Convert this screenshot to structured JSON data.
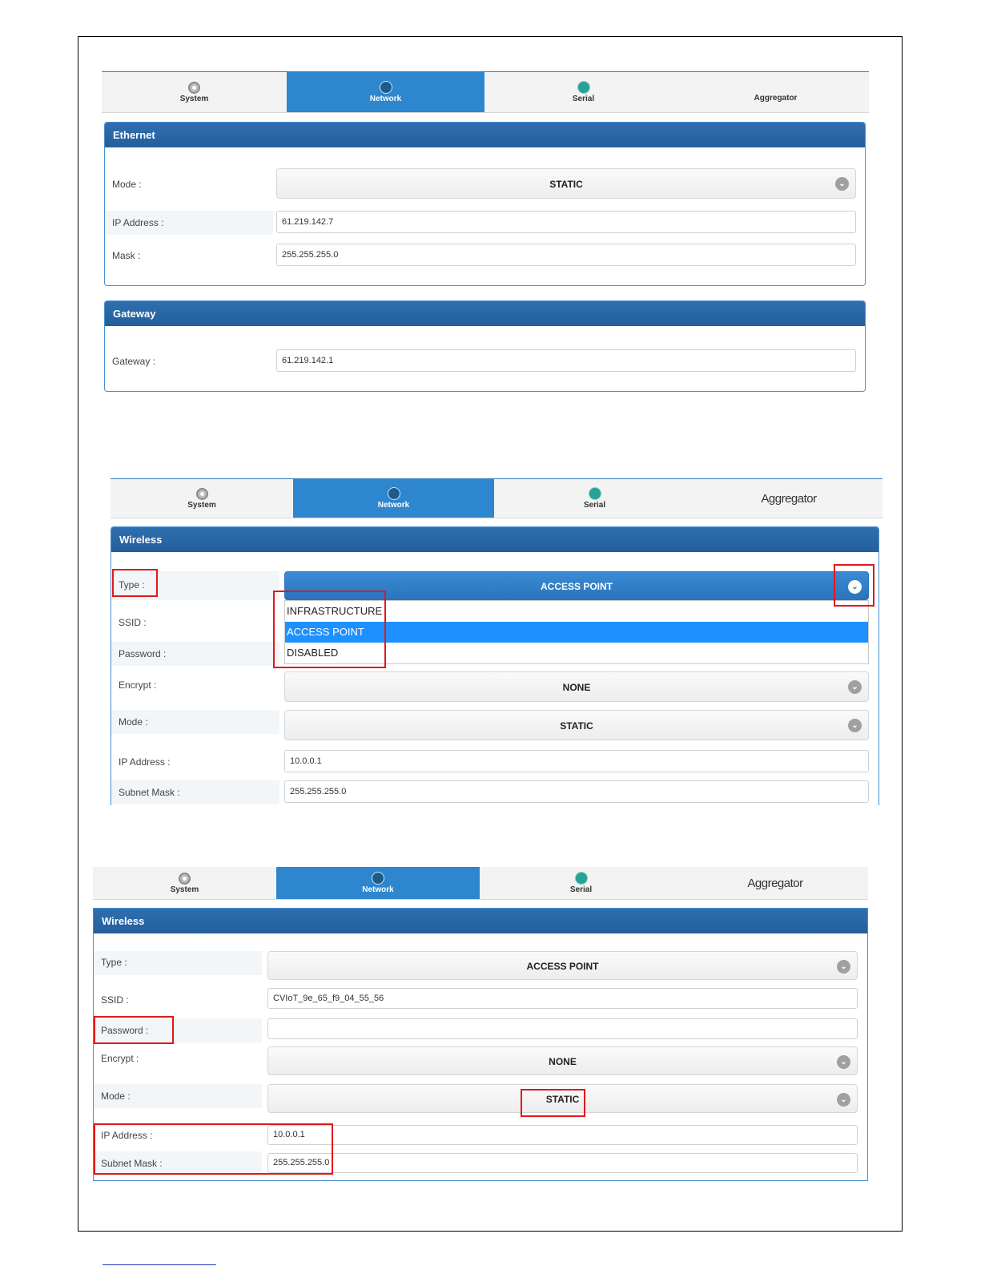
{
  "tabs": {
    "system": "System",
    "network": "Network",
    "serial": "Serial",
    "aggregator": "Aggregator"
  },
  "shot1": {
    "ethernet": {
      "title": "Ethernet",
      "mode_label": "Mode :",
      "mode_value": "STATIC",
      "ip_label": "IP Address :",
      "ip_value": "61.219.142.7",
      "mask_label": "Mask :",
      "mask_value": "255.255.255.0"
    },
    "gateway": {
      "title": "Gateway",
      "gateway_label": "Gateway :",
      "gateway_value": "61.219.142.1"
    }
  },
  "shot2": {
    "wireless": {
      "title": "Wireless",
      "type_label": "Type :",
      "type_value": "ACCESS POINT",
      "type_options": [
        "INFRASTRUCTURE",
        "ACCESS POINT",
        "DISABLED"
      ],
      "ssid_label": "SSID :",
      "password_label": "Password :",
      "encrypt_label": "Encrypt :",
      "encrypt_value": "NONE",
      "mode_label": "Mode :",
      "mode_value": "STATIC",
      "ip_label": "IP Address :",
      "ip_value": "10.0.0.1",
      "subnet_label": "Subnet Mask :",
      "subnet_value": "255.255.255.0"
    }
  },
  "shot3": {
    "wireless": {
      "title": "Wireless",
      "type_label": "Type :",
      "type_value": "ACCESS POINT",
      "ssid_label": "SSID :",
      "ssid_value": "CVIoT_9e_65_f9_04_55_56",
      "password_label": "Password :",
      "password_value": "",
      "encrypt_label": "Encrypt :",
      "encrypt_value": "NONE",
      "mode_label": "Mode :",
      "mode_value": "STATIC",
      "ip_label": "IP Address :",
      "ip_value": "10.0.0.1",
      "subnet_label": "Subnet Mask :",
      "subnet_value": "255.255.255.0"
    }
  },
  "icons": {
    "dropdown": "chevron-down-icon",
    "system": "gear-icon",
    "network": "network-icon",
    "serial": "serial-icon"
  },
  "colors": {
    "tab_active": "#2e86cf",
    "panel_header": "#2a66a5",
    "highlight": "#e0191b",
    "dropdown_selected": "#1e90ff"
  }
}
